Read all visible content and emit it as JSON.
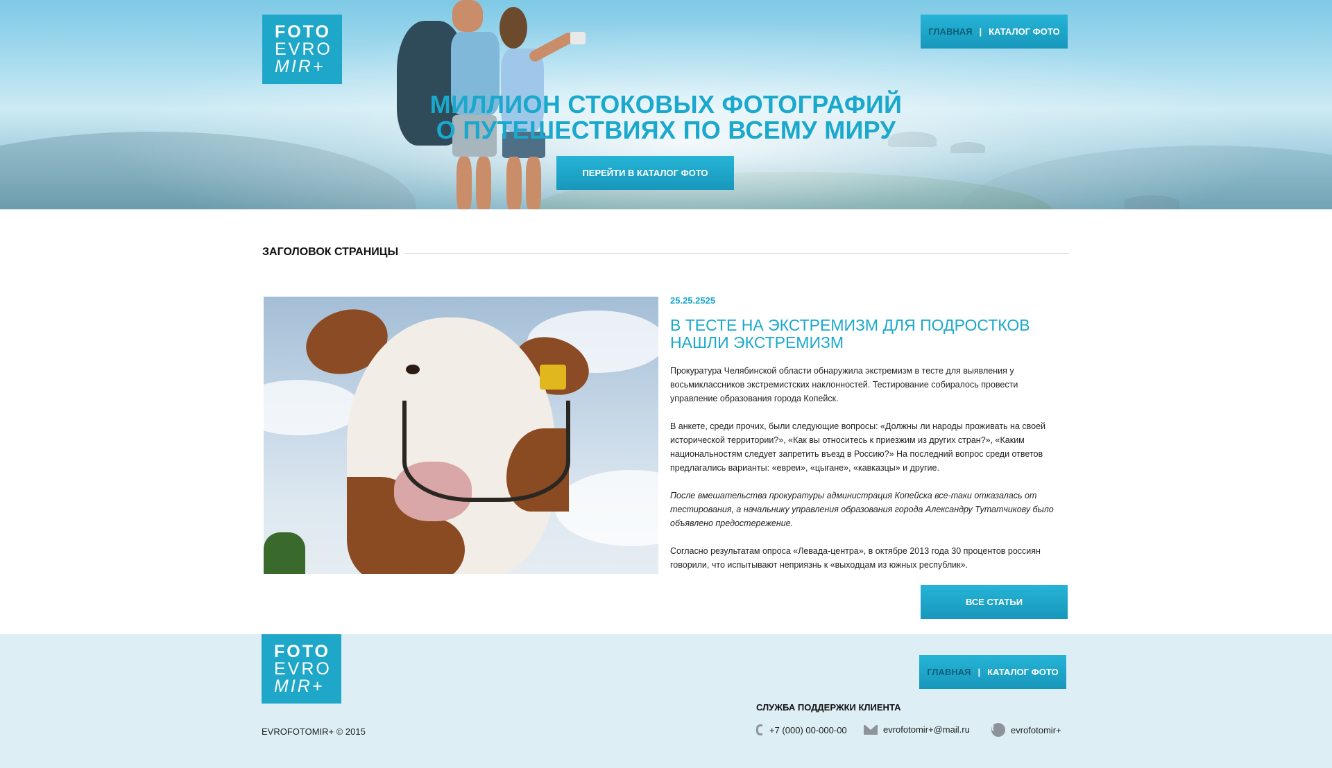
{
  "logo": {
    "line1": "FOTO",
    "line2": "EVRO",
    "line3": "MIR+"
  },
  "nav": {
    "home": "ГЛАВНАЯ",
    "separator": "|",
    "catalog": "КАТАЛОГ ФОТО"
  },
  "hero": {
    "title_line1": "МИЛЛИОН СТОКОВЫХ ФОТОГРАФИЙ",
    "title_line2": "О ПУТЕШЕСТВИЯХ ПО ВСЕМУ МИРУ",
    "button": "ПЕРЕЙТИ В КАТАЛОГ ФОТО"
  },
  "page": {
    "heading": "ЗАГОЛОВОК СТРАНИЦЫ"
  },
  "article": {
    "date": "25.25.2525",
    "title_line1": "В ТЕСТЕ НА ЭКСТРЕМИЗМ ДЛЯ ПОДРОСТКОВ",
    "title_line2": "НАШЛИ ЭКСТРЕМИЗМ",
    "paragraphs": [
      "Прокуратура Челябинской области обнаружила экстремизм в тесте для выявления у восьмиклассников экстремистских наклонностей. Тестирование собиралось провести управление образования города Копейск.",
      "В анкете, среди прочих, были следующие вопросы: «Должны ли народы проживать на своей исторической территории?», «Как вы относитесь к приезжим из других стран?», «Каким национальностям следует запретить въезд в Россию?» На последний вопрос среди ответов предлагались варианты: «евреи», «цыгане», «кавказцы» и другие.",
      "После вмешательства прокуратуры администрация Копейска все-таки отказалась от тестирования, а начальнику управления образования города Александру Тутатчикову было объявлено предостережение.",
      "Согласно результатам опроса «Левада-центра», в октябре 2013 года 30 процентов россиян говорили, что испытывают неприязнь к «выходцам из южных республик»."
    ],
    "all_button": "ВСЕ СТАТЬИ"
  },
  "footer": {
    "copyright": "EVROFOTOMIR+ © 2015",
    "support_title": "СЛУЖБА ПОДДЕРЖКИ КЛИЕНТА",
    "phone": "+7 (000) 00-000-00",
    "email": "evrofotomir+@mail.ru",
    "twitter": "evrofotomir+"
  },
  "colors": {
    "accent": "#1aa8cc",
    "footer_bg": "#ddeff5",
    "icon_gray": "#8c9499"
  },
  "icons": {
    "phone": "phone-icon",
    "mail": "mail-icon",
    "twitter": "twitter-icon"
  }
}
